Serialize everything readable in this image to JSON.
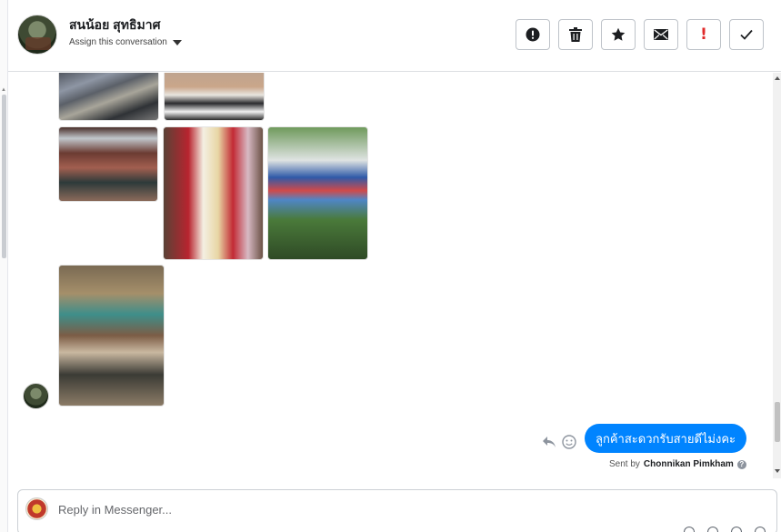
{
  "header": {
    "contact_name": "สนน้อย สุทธิมาศ",
    "assign_label": "Assign this conversation",
    "toolbar": [
      {
        "name": "spam-button",
        "icon": "exclamation-circle-icon"
      },
      {
        "name": "delete-button",
        "icon": "trash-icon"
      },
      {
        "name": "star-button",
        "icon": "star-icon"
      },
      {
        "name": "mark-unread-button",
        "icon": "envelope-icon"
      },
      {
        "name": "follow-up-button",
        "icon": "red-exclamation-icon",
        "text": "!"
      },
      {
        "name": "done-button",
        "icon": "check-icon"
      }
    ]
  },
  "conversation": {
    "photos": [
      {
        "name": "photo-grilled-fish"
      },
      {
        "name": "photo-stools"
      },
      {
        "name": "photo-restaurant-interior"
      },
      {
        "name": "photo-rice-dishes"
      },
      {
        "name": "photo-restaurant-sign"
      },
      {
        "name": "photo-antique-display"
      }
    ],
    "reply_message": {
      "text": "ลูกค้าสะดวกรับสายดีไม่งคะ",
      "sent_by_prefix": "Sent by",
      "sent_by_name": "Chonnikan Pimkham",
      "help_glyph": "?"
    }
  },
  "composer": {
    "placeholder": "Reply in Messenger..."
  },
  "colors": {
    "bubble": "#0084ff",
    "flag": "#e02b2b"
  }
}
